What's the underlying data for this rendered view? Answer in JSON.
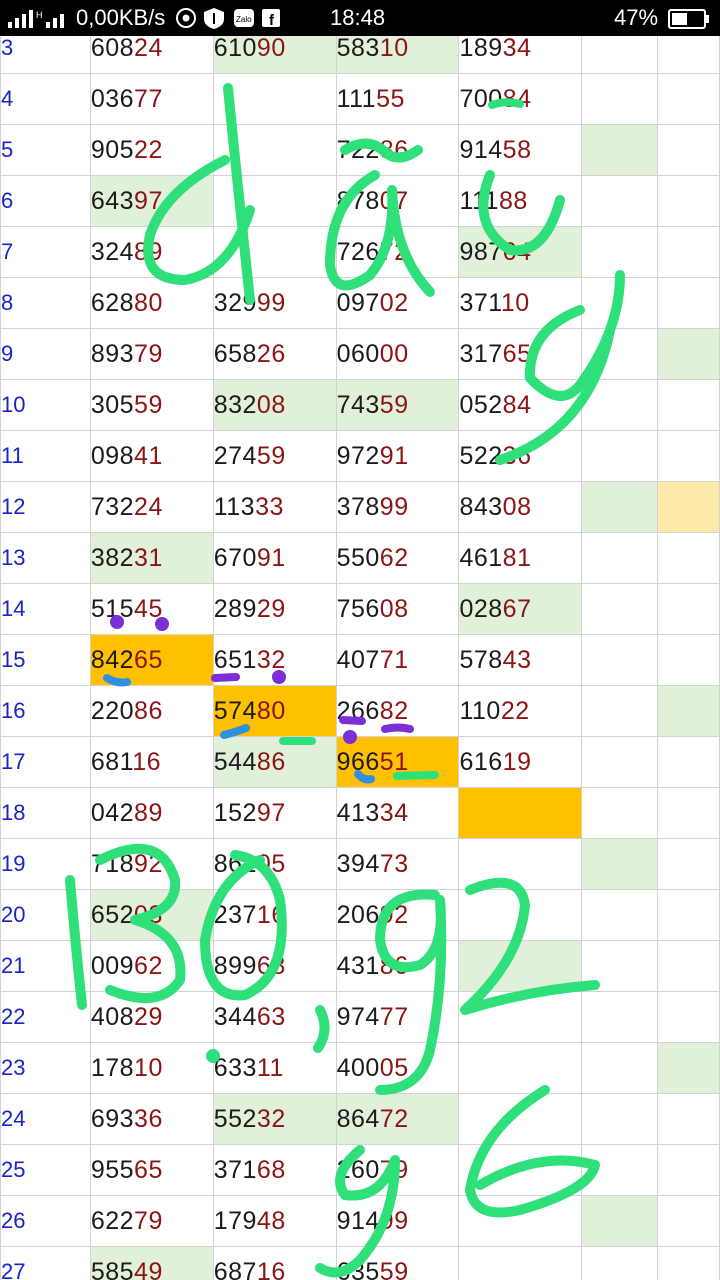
{
  "status_bar": {
    "network_speed": "0,00KB/s",
    "time": "18:48",
    "battery": "47%",
    "icons": [
      "signal-icon",
      "chrome-icon",
      "shield-icon",
      "zalo-icon",
      "facebook-icon",
      "battery-icon"
    ]
  },
  "columns": [
    "rownum",
    "c1",
    "c2",
    "c3",
    "c4",
    "c5",
    "c6"
  ],
  "rows": [
    {
      "n": "3",
      "c1": [
        "608",
        "24"
      ],
      "c2": [
        "610",
        "90"
      ],
      "c3": [
        "583",
        "10"
      ],
      "c4": [
        "189",
        "34"
      ],
      "hl": {
        "c2": "green",
        "c3": "green"
      }
    },
    {
      "n": "4",
      "c1": [
        "036",
        "77"
      ],
      "c2": [
        "",
        ""
      ],
      "c3": [
        "111",
        "55"
      ],
      "c4": [
        "700",
        "84"
      ],
      "hl": {}
    },
    {
      "n": "5",
      "c1": [
        "905",
        "22"
      ],
      "c2": [
        "",
        ""
      ],
      "c3": [
        "722",
        "86"
      ],
      "c4": [
        "914",
        "58"
      ],
      "hl": {
        "c5": "green"
      }
    },
    {
      "n": "6",
      "c1": [
        "643",
        "97"
      ],
      "c2": [
        "",
        ""
      ],
      "c3": [
        "878",
        "07"
      ],
      "c4": [
        "111",
        "88"
      ],
      "hl": {
        "c1": "green"
      }
    },
    {
      "n": "7",
      "c1": [
        "324",
        "89"
      ],
      "c2": [
        "",
        ""
      ],
      "c3": [
        "726",
        "72"
      ],
      "c4": [
        "987",
        "64"
      ],
      "hl": {
        "c4": "green"
      }
    },
    {
      "n": "8",
      "c1": [
        "628",
        "80"
      ],
      "c2": [
        "329",
        "99"
      ],
      "c3": [
        "097",
        "02"
      ],
      "c4": [
        "371",
        "10"
      ],
      "hl": {}
    },
    {
      "n": "9",
      "c1": [
        "893",
        "79"
      ],
      "c2": [
        "658",
        "26"
      ],
      "c3": [
        "060",
        "00"
      ],
      "c4": [
        "317",
        "65"
      ],
      "hl": {
        "c6": "green"
      }
    },
    {
      "n": "10",
      "c1": [
        "305",
        "59"
      ],
      "c2": [
        "832",
        "08"
      ],
      "c3": [
        "743",
        "59"
      ],
      "c4": [
        "052",
        "84"
      ],
      "hl": {
        "c2": "green",
        "c3": "green"
      }
    },
    {
      "n": "11",
      "c1": [
        "098",
        "41"
      ],
      "c2": [
        "274",
        "59"
      ],
      "c3": [
        "972",
        "91"
      ],
      "c4": [
        "522",
        "36"
      ],
      "hl": {}
    },
    {
      "n": "12",
      "c1": [
        "732",
        "24"
      ],
      "c2": [
        "113",
        "33"
      ],
      "c3": [
        "378",
        "99"
      ],
      "c4": [
        "843",
        "08"
      ],
      "hl": {
        "c5": "green",
        "c6": "yellow"
      }
    },
    {
      "n": "13",
      "c1": [
        "382",
        "31"
      ],
      "c2": [
        "670",
        "91"
      ],
      "c3": [
        "550",
        "62"
      ],
      "c4": [
        "461",
        "81"
      ],
      "hl": {
        "c1": "green"
      }
    },
    {
      "n": "14",
      "c1": [
        "515",
        "45"
      ],
      "c2": [
        "289",
        "29"
      ],
      "c3": [
        "756",
        "08"
      ],
      "c4": [
        "028",
        "67"
      ],
      "hl": {
        "c4": "green"
      }
    },
    {
      "n": "15",
      "c1": [
        "842",
        "65"
      ],
      "c2": [
        "651",
        "32"
      ],
      "c3": [
        "407",
        "71"
      ],
      "c4": [
        "578",
        "43"
      ],
      "hl": {
        "c1": "orange"
      }
    },
    {
      "n": "16",
      "c1": [
        "220",
        "86"
      ],
      "c2": [
        "574",
        "80"
      ],
      "c3": [
        "266",
        "82"
      ],
      "c4": [
        "110",
        "22"
      ],
      "hl": {
        "c2": "orange",
        "c6": "green"
      }
    },
    {
      "n": "17",
      "c1": [
        "681",
        "16"
      ],
      "c2": [
        "544",
        "86"
      ],
      "c3": [
        "966",
        "51"
      ],
      "c4": [
        "616",
        "19"
      ],
      "hl": {
        "c2": "green",
        "c3": "orange"
      }
    },
    {
      "n": "18",
      "c1": [
        "042",
        "89"
      ],
      "c2": [
        "152",
        "97"
      ],
      "c3": [
        "413",
        "34"
      ],
      "c4": [
        "",
        ""
      ],
      "hl": {
        "c4": "orange"
      }
    },
    {
      "n": "19",
      "c1": [
        "718",
        "92"
      ],
      "c2": [
        "861",
        "05"
      ],
      "c3": [
        "394",
        "73"
      ],
      "c4": [
        "",
        ""
      ],
      "hl": {
        "c5": "green"
      }
    },
    {
      "n": "20",
      "c1": [
        "652",
        "03"
      ],
      "c2": [
        "237",
        "16"
      ],
      "c3": [
        "206",
        "92"
      ],
      "c4": [
        "",
        ""
      ],
      "hl": {
        "c1": "green"
      }
    },
    {
      "n": "21",
      "c1": [
        "009",
        "62"
      ],
      "c2": [
        "899",
        "68"
      ],
      "c3": [
        "431",
        "86"
      ],
      "c4": [
        "",
        ""
      ],
      "hl": {
        "c4": "green"
      }
    },
    {
      "n": "22",
      "c1": [
        "408",
        "29"
      ],
      "c2": [
        "344",
        "63"
      ],
      "c3": [
        "974",
        "77"
      ],
      "c4": [
        "",
        ""
      ],
      "hl": {}
    },
    {
      "n": "23",
      "c1": [
        "178",
        "10"
      ],
      "c2": [
        "633",
        "11"
      ],
      "c3": [
        "400",
        "05"
      ],
      "c4": [
        "",
        ""
      ],
      "hl": {
        "c6": "green"
      }
    },
    {
      "n": "24",
      "c1": [
        "693",
        "36"
      ],
      "c2": [
        "552",
        "32"
      ],
      "c3": [
        "864",
        "72"
      ],
      "c4": [
        "",
        ""
      ],
      "hl": {
        "c2": "green",
        "c3": "green"
      }
    },
    {
      "n": "25",
      "c1": [
        "955",
        "65"
      ],
      "c2": [
        "371",
        "68"
      ],
      "c3": [
        "260",
        "79"
      ],
      "c4": [
        "",
        ""
      ],
      "hl": {}
    },
    {
      "n": "26",
      "c1": [
        "622",
        "79"
      ],
      "c2": [
        "179",
        "48"
      ],
      "c3": [
        "914",
        "99"
      ],
      "c4": [
        "",
        ""
      ],
      "hl": {
        "c5": "green"
      }
    },
    {
      "n": "27",
      "c1": [
        "585",
        "49"
      ],
      "c2": [
        "687",
        "16"
      ],
      "c3": [
        "635",
        "59"
      ],
      "c4": [
        "",
        ""
      ],
      "hl": {
        "c1": "green"
      }
    }
  ],
  "handwriting": {
    "top_word": "dây",
    "bottom_numbers": "30,92",
    "bottom_extra": "96",
    "ink_color": "#2fe07a",
    "marker_purple": "#7b2fd6",
    "marker_blue": "#2f8fe0"
  }
}
